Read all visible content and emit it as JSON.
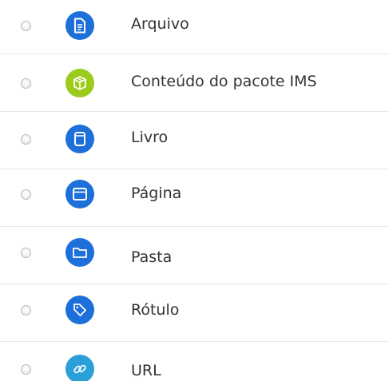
{
  "colors": {
    "icon_blue": "#1d6fd9",
    "icon_green": "#9ccb1c",
    "icon_teal": "#2ba0d8",
    "text": "#333333",
    "divider": "#e6e6e6"
  },
  "items": [
    {
      "label": "Arquivo",
      "icon": "file-icon",
      "icon_color": "#1d6fd9"
    },
    {
      "label": "Conteúdo do pacote IMS",
      "icon": "package-icon",
      "icon_color": "#9ccb1c"
    },
    {
      "label": "Livro",
      "icon": "book-icon",
      "icon_color": "#1d6fd9"
    },
    {
      "label": "Página",
      "icon": "page-icon",
      "icon_color": "#1d6fd9"
    },
    {
      "label": "Pasta",
      "icon": "folder-icon",
      "icon_color": "#1d6fd9"
    },
    {
      "label": "Rótulo",
      "icon": "tag-icon",
      "icon_color": "#1d6fd9"
    },
    {
      "label": "URL",
      "icon": "link-icon",
      "icon_color": "#2ba0d8"
    }
  ]
}
